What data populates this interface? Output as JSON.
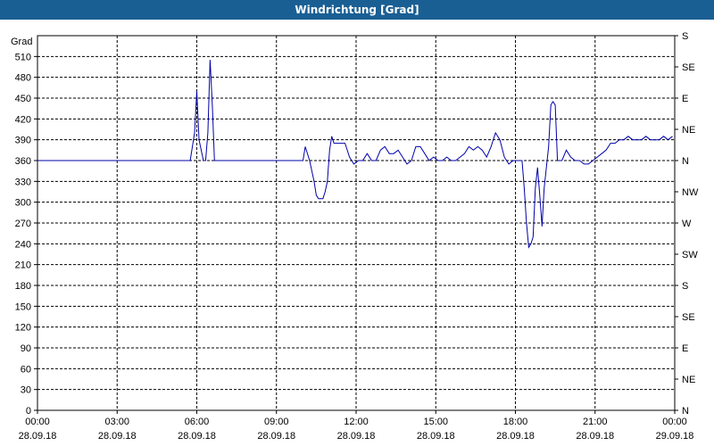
{
  "window": {
    "title": "Windrichtung [Grad]"
  },
  "colors": {
    "titlebar": "#1a5f94",
    "series": "#0000aa",
    "grid": "#000000"
  },
  "chart_data": {
    "type": "line",
    "title": "Windrichtung [Grad]",
    "ylabel": "Grad",
    "xlabel": "",
    "ylim": [
      0,
      540
    ],
    "xlim": [
      "2018-09-28 00:00",
      "2018-09-29 00:00"
    ],
    "grid": true,
    "y_ticks": [
      0,
      30,
      60,
      90,
      120,
      150,
      180,
      210,
      240,
      270,
      300,
      330,
      360,
      390,
      420,
      450,
      480,
      510
    ],
    "y2_ticks": [
      {
        "value": 0,
        "label": "N"
      },
      {
        "value": 45,
        "label": "NE"
      },
      {
        "value": 90,
        "label": "E"
      },
      {
        "value": 135,
        "label": "SE"
      },
      {
        "value": 180,
        "label": "S"
      },
      {
        "value": 225,
        "label": "SW"
      },
      {
        "value": 270,
        "label": "W"
      },
      {
        "value": 315,
        "label": "NW"
      },
      {
        "value": 360,
        "label": "N"
      },
      {
        "value": 405,
        "label": "NE"
      },
      {
        "value": 450,
        "label": "E"
      },
      {
        "value": 495,
        "label": "SE"
      },
      {
        "value": 540,
        "label": "S"
      }
    ],
    "x_ticks": [
      {
        "time": "00:00",
        "date": "28.09.18"
      },
      {
        "time": "03:00",
        "date": "28.09.18"
      },
      {
        "time": "06:00",
        "date": "28.09.18"
      },
      {
        "time": "09:00",
        "date": "28.09.18"
      },
      {
        "time": "12:00",
        "date": "28.09.18"
      },
      {
        "time": "15:00",
        "date": "28.09.18"
      },
      {
        "time": "18:00",
        "date": "28.09.18"
      },
      {
        "time": "21:00",
        "date": "28.09.18"
      },
      {
        "time": "00:00",
        "date": "29.09.18"
      }
    ],
    "series": [
      {
        "x": [
          "00:00",
          "05:45",
          "05:55",
          "06:00",
          "06:05",
          "06:15",
          "06:20",
          "06:25",
          "06:30",
          "06:35",
          "06:40",
          "09:00",
          "10:00",
          "10:05",
          "10:15",
          "10:25",
          "10:30",
          "10:35",
          "10:45",
          "10:50",
          "10:55",
          "11:00",
          "11:05",
          "11:10",
          "11:15",
          "11:25",
          "11:35",
          "11:45",
          "11:55",
          "12:05",
          "12:15",
          "12:25",
          "12:35",
          "12:45",
          "12:55",
          "13:05",
          "13:15",
          "13:25",
          "13:35",
          "13:45",
          "13:55",
          "14:05",
          "14:15",
          "14:25",
          "14:35",
          "14:45",
          "14:55",
          "15:05",
          "15:15",
          "15:25",
          "15:35",
          "15:45",
          "15:55",
          "16:05",
          "16:15",
          "16:25",
          "16:35",
          "16:45",
          "16:55",
          "17:05",
          "17:15",
          "17:25",
          "17:35",
          "17:45",
          "17:55",
          "18:00",
          "18:15",
          "18:20",
          "18:25",
          "18:30",
          "18:35",
          "18:40",
          "18:45",
          "18:50",
          "18:55",
          "19:00",
          "19:05",
          "19:15",
          "19:20",
          "19:25",
          "19:30",
          "19:35",
          "19:45",
          "19:55",
          "20:05",
          "20:15",
          "20:25",
          "20:35",
          "20:45",
          "20:55",
          "21:05",
          "21:15",
          "21:25",
          "21:35",
          "21:45",
          "21:55",
          "22:05",
          "22:15",
          "22:25",
          "22:35",
          "22:45",
          "22:55",
          "23:05",
          "23:15",
          "23:25",
          "23:35",
          "23:45",
          "23:55"
        ],
        "y": [
          360,
          360,
          400,
          460,
          390,
          360,
          360,
          400,
          505,
          440,
          360,
          360,
          360,
          380,
          360,
          330,
          310,
          305,
          305,
          315,
          330,
          375,
          395,
          385,
          385,
          385,
          385,
          365,
          355,
          360,
          360,
          370,
          360,
          360,
          375,
          380,
          370,
          370,
          375,
          365,
          355,
          360,
          380,
          380,
          370,
          360,
          365,
          360,
          360,
          365,
          360,
          360,
          365,
          370,
          380,
          375,
          380,
          375,
          365,
          380,
          400,
          390,
          365,
          355,
          360,
          360,
          360,
          320,
          270,
          235,
          240,
          250,
          320,
          350,
          310,
          265,
          320,
          380,
          440,
          445,
          440,
          360,
          360,
          375,
          365,
          360,
          360,
          355,
          355,
          360,
          365,
          370,
          375,
          385,
          385,
          390,
          390,
          395,
          390,
          390,
          390,
          395,
          390,
          390,
          390,
          395,
          390,
          395
        ]
      }
    ]
  }
}
